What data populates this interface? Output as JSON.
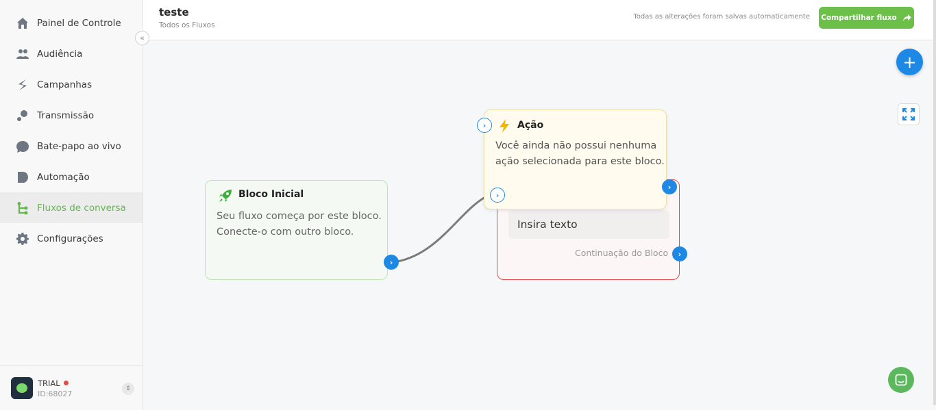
{
  "sidebar": {
    "items": [
      {
        "label": "Painel de Controle",
        "icon": "home-icon"
      },
      {
        "label": "Audiência",
        "icon": "people-icon"
      },
      {
        "label": "Campanhas",
        "icon": "campaign-icon"
      },
      {
        "label": "Transmissão",
        "icon": "broadcast-icon"
      },
      {
        "label": "Bate-papo ao vivo",
        "icon": "chat-bubble-icon"
      },
      {
        "label": "Automação",
        "icon": "automation-icon"
      },
      {
        "label": "Fluxos de conversa",
        "icon": "flow-icon",
        "active": true
      },
      {
        "label": "Configurações",
        "icon": "gear-icon"
      }
    ],
    "account": {
      "plan": "TRIAL",
      "id": "ID:68027"
    }
  },
  "header": {
    "title": "teste",
    "breadcrumb": "Todos os Fluxos",
    "autosave": "Todas as alterações foram salvas automaticamente",
    "share_label": "Compartilhar fluxo"
  },
  "blocks": {
    "start": {
      "title": "Bloco Inicial",
      "body_line1": "Seu fluxo começa por este bloco.",
      "body_line2": "Conecte-o com outro bloco."
    },
    "action": {
      "title": "Ação",
      "body_line1": "Você ainda não possui nenhuma",
      "body_line2": "ação selecionada para este bloco."
    },
    "message": {
      "input_text": "Insira texto",
      "continuation": "Continuação do Bloco"
    }
  },
  "colors": {
    "accent_green": "#6cc04a",
    "accent_blue": "#1e88e5",
    "error_red": "#e84c4c"
  }
}
